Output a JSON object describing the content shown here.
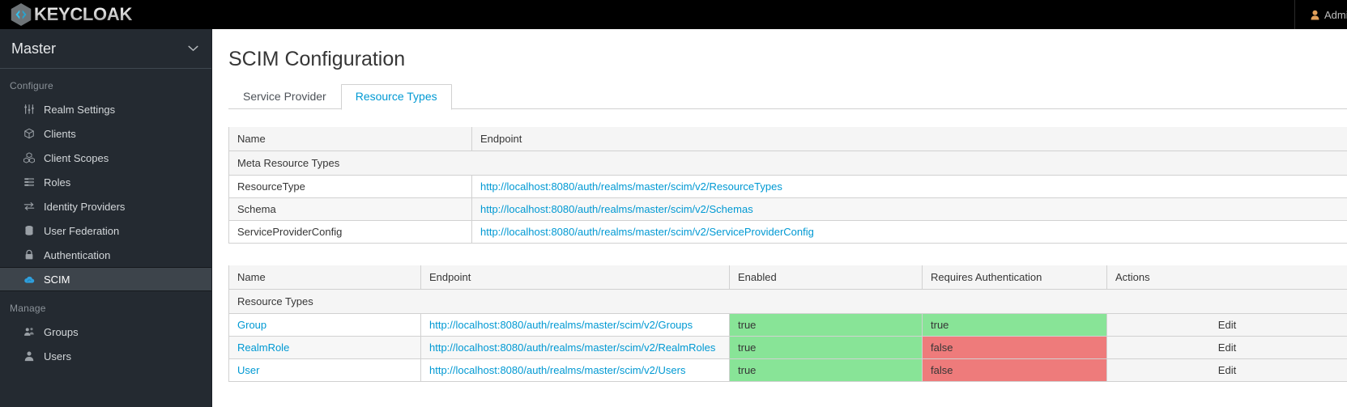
{
  "header": {
    "brand": "KEYCLOAK",
    "brand_logo_icon": "keycloak-hexagon-logo",
    "user_icon": "user-avatar-icon",
    "user_name": "Admin"
  },
  "sidebar": {
    "realm": {
      "name": "Master",
      "chevron_icon": "chevron-down-icon"
    },
    "sections": [
      {
        "label": "Configure",
        "items": [
          {
            "label": "Realm Settings",
            "icon": "sliders-icon",
            "active": false
          },
          {
            "label": "Clients",
            "icon": "cube-icon",
            "active": false
          },
          {
            "label": "Client Scopes",
            "icon": "cubes-icon",
            "active": false
          },
          {
            "label": "Roles",
            "icon": "list-icon",
            "active": false
          },
          {
            "label": "Identity Providers",
            "icon": "exchange-arrows-icon",
            "active": false
          },
          {
            "label": "User Federation",
            "icon": "database-icon",
            "active": false
          },
          {
            "label": "Authentication",
            "icon": "lock-icon",
            "active": false
          },
          {
            "label": "SCIM",
            "icon": "cloud-sync-icon",
            "active": true
          }
        ]
      },
      {
        "label": "Manage",
        "items": [
          {
            "label": "Groups",
            "icon": "users-group-icon",
            "active": false
          },
          {
            "label": "Users",
            "icon": "user-icon",
            "active": false
          }
        ]
      }
    ]
  },
  "main": {
    "page_title": "SCIM Configuration",
    "tabs": [
      {
        "label": "Service Provider",
        "active": false
      },
      {
        "label": "Resource Types",
        "active": true
      }
    ],
    "meta_resource_types": {
      "caption": "Meta Resource Types",
      "columns": [
        "Name",
        "Endpoint"
      ],
      "rows": [
        {
          "name": "ResourceType",
          "endpoint": "http://localhost:8080/auth/realms/master/scim/v2/ResourceTypes"
        },
        {
          "name": "Schema",
          "endpoint": "http://localhost:8080/auth/realms/master/scim/v2/Schemas"
        },
        {
          "name": "ServiceProviderConfig",
          "endpoint": "http://localhost:8080/auth/realms/master/scim/v2/ServiceProviderConfig"
        }
      ]
    },
    "resource_types": {
      "caption": "Resource Types",
      "columns": [
        "Name",
        "Endpoint",
        "Enabled",
        "Requires Authentication",
        "Actions"
      ],
      "rows": [
        {
          "name": "Group",
          "endpoint": "http://localhost:8080/auth/realms/master/scim/v2/Groups",
          "enabled": "true",
          "requires_auth": "true",
          "action": "Edit"
        },
        {
          "name": "RealmRole",
          "endpoint": "http://localhost:8080/auth/realms/master/scim/v2/RealmRoles",
          "enabled": "true",
          "requires_auth": "false",
          "action": "Edit"
        },
        {
          "name": "User",
          "endpoint": "http://localhost:8080/auth/realms/master/scim/v2/Users",
          "enabled": "true",
          "requires_auth": "false",
          "action": "Edit"
        }
      ]
    }
  },
  "colors": {
    "accent_link": "#0099d3",
    "true_bg": "#88e497",
    "false_bg": "#ee7b7b",
    "sidebar_bg": "#242a31",
    "topbar_bg": "#000000"
  }
}
